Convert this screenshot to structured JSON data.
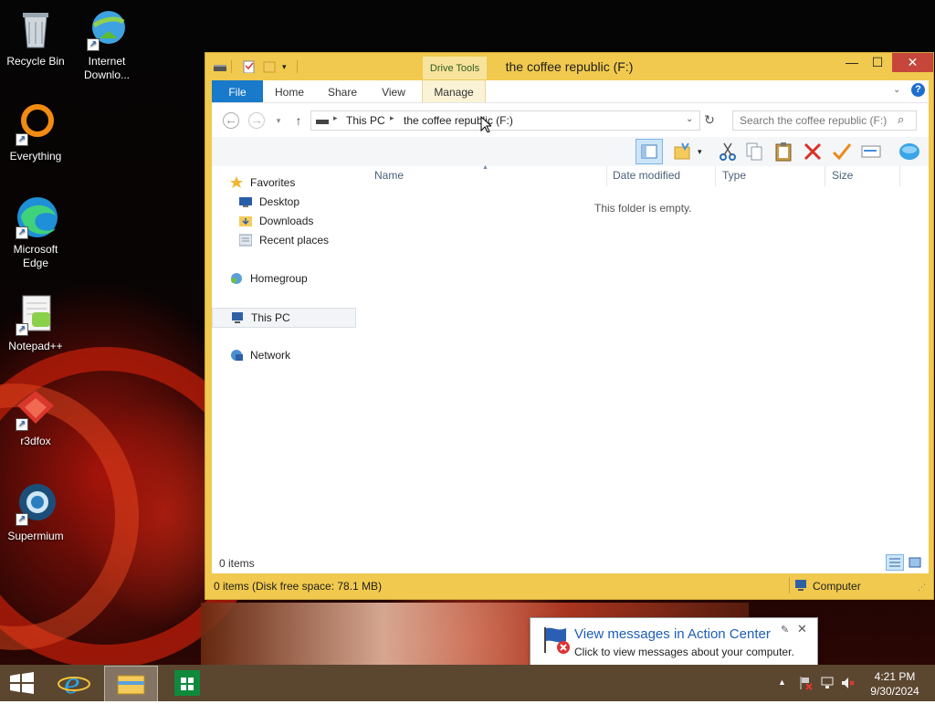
{
  "desktop": {
    "icons": [
      {
        "label": "Recycle Bin"
      },
      {
        "label": "Internet Downlo..."
      },
      {
        "label": "Everything"
      },
      {
        "label": "Microsoft Edge"
      },
      {
        "label": "Notepad++"
      },
      {
        "label": "r3dfox"
      },
      {
        "label": "Supermium"
      }
    ]
  },
  "window": {
    "title": "the coffee republic (F:)",
    "context_tab_group": "Drive Tools",
    "tabs": [
      "File",
      "Home",
      "Share",
      "View",
      "Manage"
    ],
    "breadcrumb": [
      "This PC",
      "the coffee republic (F:)"
    ],
    "search_placeholder": "Search the coffee republic (F:)",
    "nav_pane": {
      "favorites": "Favorites",
      "favorites_items": [
        "Desktop",
        "Downloads",
        "Recent places"
      ],
      "homegroup": "Homegroup",
      "this_pc": "This PC",
      "network": "Network"
    },
    "columns": [
      "Name",
      "Date modified",
      "Type",
      "Size"
    ],
    "empty_message": "This folder is empty.",
    "item_count": "0 items",
    "status_left": "0 items (Disk free space: 78.1 MB)",
    "status_right": "Computer"
  },
  "taskbar": {
    "time": "4:21 PM",
    "date": "9/30/2024"
  },
  "notification": {
    "title": "View messages in Action Center",
    "body": "Click to view messages about your computer."
  },
  "colors": {
    "window_frame": "#f0c94e",
    "file_tab": "#1979ca",
    "close_button": "#c7463b",
    "taskbar": "#5b4630"
  }
}
